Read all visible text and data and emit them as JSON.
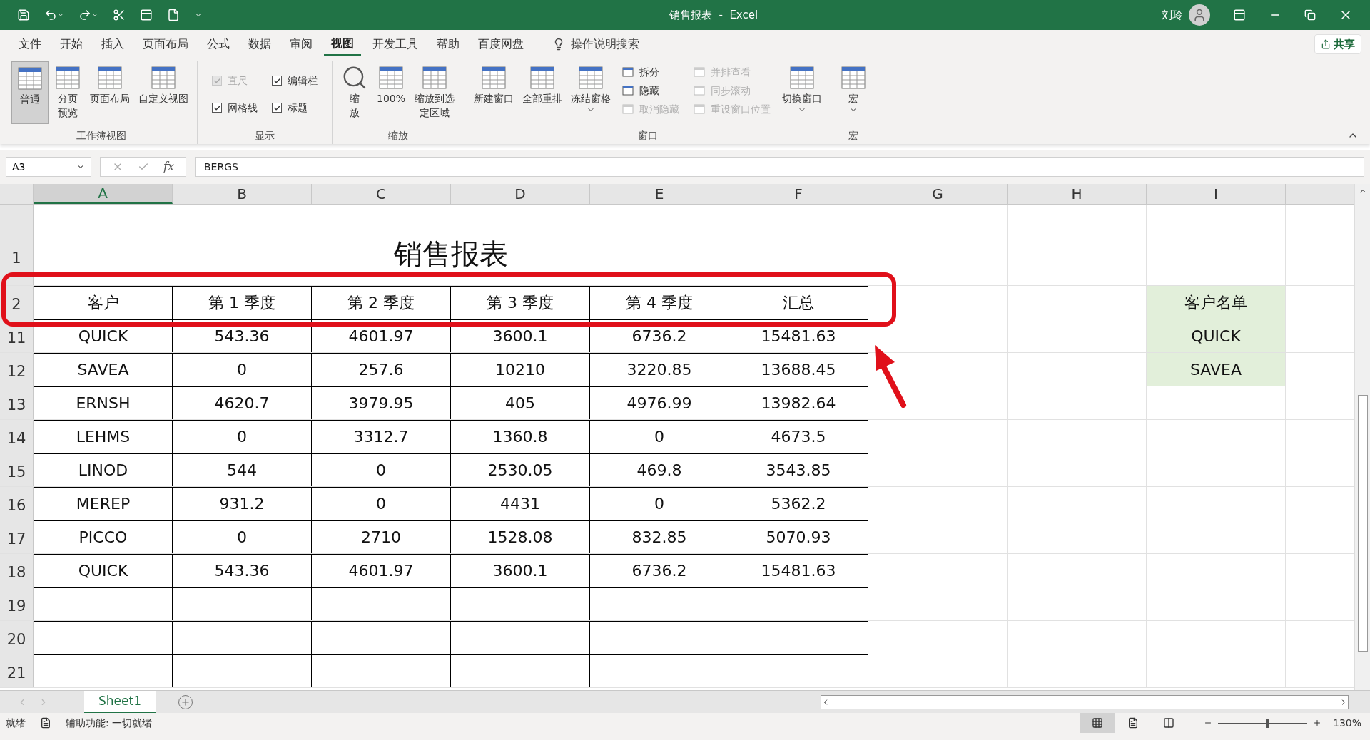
{
  "title_bar": {
    "title": "销售报表  -  Excel",
    "user": "刘玲"
  },
  "menu_tabs": [
    {
      "label": "文件",
      "selected": false
    },
    {
      "label": "开始",
      "selected": false
    },
    {
      "label": "插入",
      "selected": false
    },
    {
      "label": "页面布局",
      "selected": false
    },
    {
      "label": "公式",
      "selected": false
    },
    {
      "label": "数据",
      "selected": false
    },
    {
      "label": "审阅",
      "selected": false
    },
    {
      "label": "视图",
      "selected": true
    },
    {
      "label": "开发工具",
      "selected": false
    },
    {
      "label": "帮助",
      "selected": false
    },
    {
      "label": "百度网盘",
      "selected": false
    }
  ],
  "tell_me": "操作说明搜索",
  "share": "共享",
  "ribbon_groups": [
    {
      "label": "工作簿视图",
      "items": [
        {
          "kind": "large",
          "label": "普通",
          "selected": true
        },
        {
          "kind": "large",
          "label": "分页预览",
          "selected": false
        },
        {
          "kind": "large",
          "label": "页面布局",
          "selected": false
        },
        {
          "kind": "large",
          "label": "自定义视图",
          "selected": false
        }
      ]
    },
    {
      "label": "显示",
      "items": [
        {
          "kind": "check",
          "label": "直尺",
          "checked": true,
          "disabled": true
        },
        {
          "kind": "check",
          "label": "编辑栏",
          "checked": true,
          "disabled": false
        },
        {
          "kind": "check",
          "label": "网格线",
          "checked": true,
          "disabled": false
        },
        {
          "kind": "check",
          "label": "标题",
          "checked": true,
          "disabled": false
        }
      ]
    },
    {
      "label": "缩放",
      "items": [
        {
          "kind": "large",
          "label": "缩放",
          "selected": false
        },
        {
          "kind": "large",
          "label": "100%",
          "selected": false
        },
        {
          "kind": "large",
          "label": "缩放到选定区域",
          "selected": false
        }
      ]
    },
    {
      "label": "窗口",
      "items": [
        {
          "kind": "large",
          "label": "新建窗口",
          "selected": false
        },
        {
          "kind": "large",
          "label": "全部重排",
          "selected": false
        },
        {
          "kind": "dropdown",
          "label": "冻结窗格"
        },
        {
          "kind": "stack",
          "entries": [
            {
              "label": "拆分",
              "disabled": false
            },
            {
              "label": "隐藏",
              "disabled": false
            },
            {
              "label": "取消隐藏",
              "disabled": true
            }
          ]
        },
        {
          "kind": "stack",
          "entries": [
            {
              "label": "并排查看",
              "disabled": true
            },
            {
              "label": "同步滚动",
              "disabled": true
            },
            {
              "label": "重设窗口位置",
              "disabled": true
            }
          ]
        },
        {
          "kind": "dropdown",
          "label": "切换窗口"
        }
      ]
    },
    {
      "label": "宏",
      "items": [
        {
          "kind": "dropdown",
          "label": "宏"
        }
      ]
    }
  ],
  "formula_bar": {
    "name_box": "A3",
    "function_label": "fx",
    "value": "BERGS"
  },
  "columns": [
    {
      "label": "A",
      "selected": true
    },
    {
      "label": "B",
      "selected": false
    },
    {
      "label": "C",
      "selected": false
    },
    {
      "label": "D",
      "selected": false
    },
    {
      "label": "E",
      "selected": false
    },
    {
      "label": "F",
      "selected": false
    },
    {
      "label": "G",
      "selected": false
    },
    {
      "label": "H",
      "selected": false
    },
    {
      "label": "I",
      "selected": false
    }
  ],
  "rows": [
    {
      "number": "1",
      "kind": "title",
      "text": "销售报表"
    },
    {
      "number": "2",
      "kind": "header",
      "cells": [
        "客户",
        "第 1 季度",
        "第 2 季度",
        "第 3 季度",
        "第 4 季度",
        "汇总"
      ],
      "side": "客户名单"
    },
    {
      "number": "11",
      "kind": "data",
      "cells": [
        "QUICK",
        "543.36",
        "4601.97",
        "3600.1",
        "6736.2",
        "15481.63"
      ],
      "side": "QUICK"
    },
    {
      "number": "12",
      "kind": "data",
      "cells": [
        "SAVEA",
        "0",
        "257.6",
        "10210",
        "3220.85",
        "13688.45"
      ],
      "side": "SAVEA"
    },
    {
      "number": "13",
      "kind": "data",
      "cells": [
        "ERNSH",
        "4620.7",
        "3979.95",
        "405",
        "4976.99",
        "13982.64"
      ]
    },
    {
      "number": "14",
      "kind": "data",
      "cells": [
        "LEHMS",
        "0",
        "3312.7",
        "1360.8",
        "0",
        "4673.5"
      ]
    },
    {
      "number": "15",
      "kind": "data",
      "cells": [
        "LINOD",
        "544",
        "0",
        "2530.05",
        "469.8",
        "3543.85"
      ]
    },
    {
      "number": "16",
      "kind": "data",
      "cells": [
        "MEREP",
        "931.2",
        "0",
        "4431",
        "0",
        "5362.2"
      ]
    },
    {
      "number": "17",
      "kind": "data",
      "cells": [
        "PICCO",
        "0",
        "2710",
        "1528.08",
        "832.85",
        "5070.93"
      ]
    },
    {
      "number": "18",
      "kind": "data",
      "cells": [
        "QUICK",
        "543.36",
        "4601.97",
        "3600.1",
        "6736.2",
        "15481.63"
      ]
    },
    {
      "number": "19",
      "kind": "empty"
    },
    {
      "number": "20",
      "kind": "empty"
    },
    {
      "number": "21",
      "kind": "empty"
    }
  ],
  "sheet_tabs": [
    {
      "label": "Sheet1",
      "selected": true
    }
  ],
  "status_bar": {
    "ready": "就绪",
    "accessibility": "辅助功能: 一切就绪",
    "views": [
      {
        "selected": true
      },
      {
        "selected": false
      },
      {
        "selected": false
      }
    ],
    "zoom": {
      "level": 0.55,
      "reading": "130%"
    }
  }
}
